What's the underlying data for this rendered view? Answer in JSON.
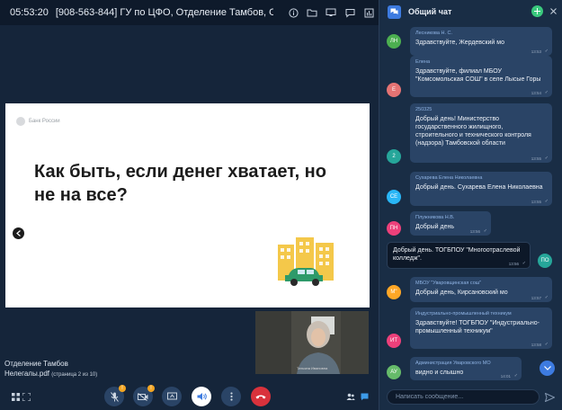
{
  "topbar": {
    "time": "05:53:20",
    "title": "[908-563-844] ГУ по ЦФО, Отделение Тамбов, Отдел ин...",
    "tools": [
      "info-icon",
      "folder-icon",
      "screen-share-icon",
      "chat-bubble-icon",
      "stats-icon"
    ]
  },
  "slide": {
    "bank_label": "Банк России",
    "headline": "Как быть, если денег хватает, но не на все?"
  },
  "selfview": {
    "caption": "Татьяна Ивановна"
  },
  "presenter": {
    "name": "Отделение Тамбов",
    "file": "Нелегалы.pdf",
    "pages": "(страница 2 из 10)"
  },
  "controls": {
    "mic_badge": "!",
    "cam_badge": "!"
  },
  "chat": {
    "title": "Общий чат",
    "input_placeholder": "Написать сообщение...",
    "messages": [
      {
        "author": "Лесникова Н. С.",
        "text": "Здравствуйте, Жердевский мо",
        "time": "13:53",
        "initials": "ЛН",
        "color": "#4caf50"
      },
      {
        "author": "Елена",
        "text": "Здравствуйте, филиал МБОУ \"Комсомольская СОШ\" в селе Лысые Горы",
        "time": "13:54",
        "initials": "Е",
        "color": "#e57373"
      },
      {
        "author": "250325",
        "text": "Добрый день! Министерство государственного жилищного, строительного и технического контроля (надзора) Тамбовской области",
        "time": "13:55",
        "initials": "2",
        "color": "#26a69a"
      },
      {
        "author": "Сухарева Елена Николаевна",
        "text": "Добрый день. Сухарева Елена Николаевна",
        "time": "13:55",
        "initials": "СЕ",
        "color": "#29b6f6"
      },
      {
        "author": "Плужникова Н.В.",
        "text": "Добрый день",
        "time": "13:56",
        "initials": "ПН",
        "color": "#ec407a"
      },
      {
        "author": "",
        "text": "Добрый день. ТОГБПОУ \"Многоотраслевой колледж\".",
        "time": "13:56",
        "initials": "ПО",
        "color": "#26a69a"
      },
      {
        "author": "МБОУ \"Уваровщинская сош\"",
        "text": "Добрый день, Кирсановский мо",
        "time": "13:57",
        "initials": "М\"",
        "color": "#ffa726"
      },
      {
        "author": "Индустриально-промышленный техникум",
        "text": "Здравствуйте! ТОГБПОУ \"Индустриально-промышленный техникум\"",
        "time": "13:58",
        "initials": "ИТ",
        "color": "#ec407a"
      },
      {
        "author": "Администрация Уваровского МО",
        "text": "видно и слышно",
        "time": "14:01",
        "initials": "АУ",
        "color": "#66bb6a"
      }
    ]
  }
}
